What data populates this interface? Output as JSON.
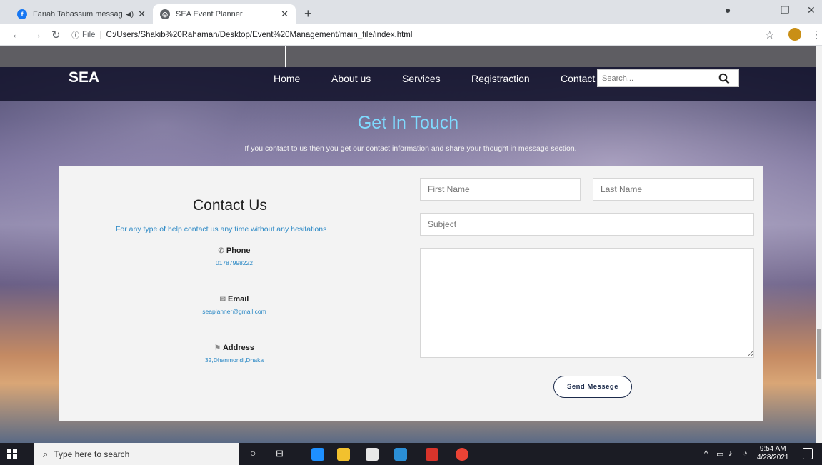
{
  "browser": {
    "tabs": [
      {
        "title": "Fariah Tabassum messaged y",
        "icon": "facebook-icon",
        "active": false
      },
      {
        "title": "SEA Event Planner",
        "icon": "globe-icon",
        "active": true
      }
    ],
    "url_scheme_label": "File",
    "url": "C:/Users/Shakib%20Rahaman/Desktop/Event%20Management/main_file/index.html"
  },
  "site": {
    "brand": "SEA",
    "menu": [
      "Home",
      "About us",
      "Services",
      "Registraction",
      "Contact"
    ],
    "search_placeholder": "Search..."
  },
  "hero": {
    "title": "Get In Touch",
    "subtitle": "If you contact to us then you get our contact information and share your thought in message section."
  },
  "contact": {
    "title": "Contact Us",
    "description": "For any type of help contact us any time without any hesitations",
    "phone_label": "Phone",
    "phone": "01787998222",
    "email_label": "Email",
    "email": "seaplanner@gmail.com",
    "address_label": "Address",
    "address": "32,Dhanmondi,Dhaka"
  },
  "form": {
    "first_name_placeholder": "First Name",
    "last_name_placeholder": "Last Name",
    "subject_placeholder": "Subject",
    "send_label": "Send Messege"
  },
  "taskbar": {
    "search_placeholder": "Type here to search",
    "time": "9:54 AM",
    "date": "4/28/2021"
  }
}
